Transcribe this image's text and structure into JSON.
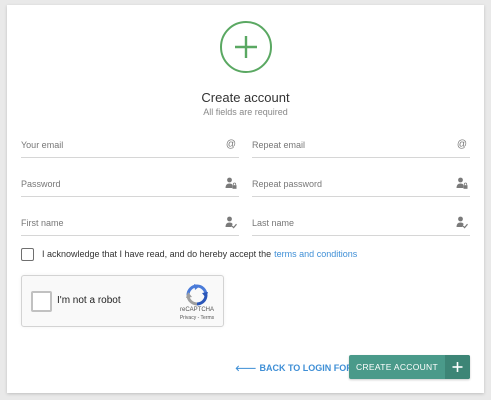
{
  "header": {
    "title": "Create account",
    "subtitle": "All fields are required"
  },
  "fields": {
    "email": {
      "placeholder": "Your email",
      "icon": "at-icon",
      "value": ""
    },
    "repeat_email": {
      "placeholder": "Repeat email",
      "icon": "at-icon",
      "value": ""
    },
    "password": {
      "placeholder": "Password",
      "icon": "user-lock-icon",
      "value": ""
    },
    "repeat_password": {
      "placeholder": "Repeat password",
      "icon": "user-lock-icon",
      "value": ""
    },
    "first_name": {
      "placeholder": "First name",
      "icon": "user-check-icon",
      "value": ""
    },
    "last_name": {
      "placeholder": "Last name",
      "icon": "user-check-icon",
      "value": ""
    }
  },
  "terms": {
    "checked": false,
    "text": "I acknowledge that I have read, and do hereby accept the",
    "link": "terms and conditions"
  },
  "recaptcha": {
    "label": "I'm not a robot",
    "brand": "reCAPTCHA",
    "links": "Privacy - Terms"
  },
  "actions": {
    "back_label": "BACK TO LOGIN FORM",
    "create_label": "CREATE ACCOUNT"
  },
  "colors": {
    "accent_green": "#5aa862",
    "button_teal": "#4a9a8a",
    "button_teal_dark": "#3d8576",
    "link_blue": "#3f8fd6"
  }
}
